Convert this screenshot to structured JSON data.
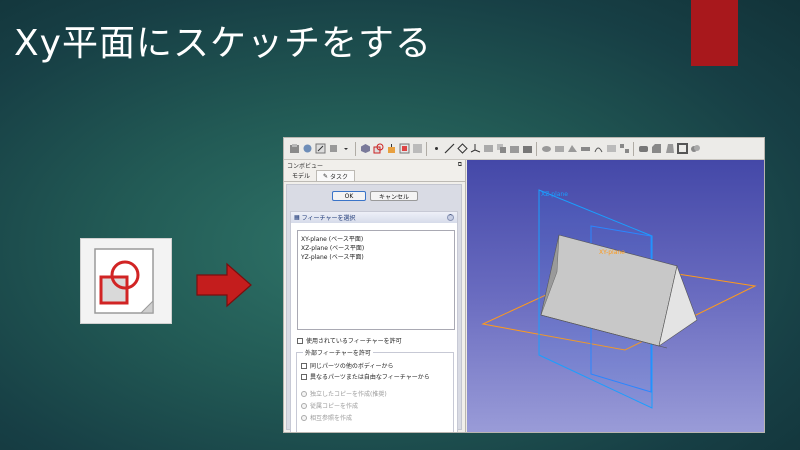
{
  "slide": {
    "title": "Xy平面にスケッチをする",
    "colors": {
      "accent_red": "#a8181c",
      "title": "#ffffff"
    }
  },
  "icon": {
    "name": "sketch-icon"
  },
  "freecad": {
    "toolbar_icons": [
      "part-icon",
      "extrude-icon",
      "attach-icon",
      "shape-icon",
      "dropdown-icon",
      "body-icon",
      "sketch-icon",
      "pad-icon",
      "pocket-icon",
      "revolution-icon",
      "point-icon",
      "line-icon",
      "plane-icon",
      "csys-icon",
      "binder-icon",
      "clone-icon",
      "pad2-icon",
      "pocket2-icon",
      "hole-icon",
      "groove-icon",
      "loft-icon",
      "pipe-icon",
      "helix-icon",
      "mirror-icon",
      "pattern-icon",
      "fillet-icon",
      "chamfer-icon",
      "draft-icon",
      "thickness-icon",
      "boolean-icon"
    ],
    "combo_view": {
      "title": "コンボビュー",
      "tabs": [
        {
          "label": "モデル"
        },
        {
          "label": "タスク"
        }
      ],
      "ok_label": "OK",
      "cancel_label": "キャンセル",
      "feature_panel_title": "フィーチャーを選択",
      "features": [
        "XY-plane (ベース平面)",
        "XZ-plane (ベース平面)",
        "YZ-plane (ベース平面)"
      ],
      "allow_used_label": "使用されているフィーチャーを許可",
      "external_group_label": "外部フィーチャーを許可",
      "external_options": [
        "同じパーツの他のボディーから",
        "異なるパーツまたは自由なフィーチャーから"
      ],
      "copy_options": [
        "独立したコピーを作成(推奨)",
        "従属コピーを作成",
        "相互参照を作成"
      ]
    },
    "viewport": {
      "plane_labels": [
        "XY-plane",
        "XZ-plane",
        "YZ-plane"
      ],
      "colors": {
        "xy": "#ff9a1a",
        "xz": "#1a9fff",
        "yz": "#2a86ff",
        "solid": "#c8c8c8"
      }
    }
  }
}
